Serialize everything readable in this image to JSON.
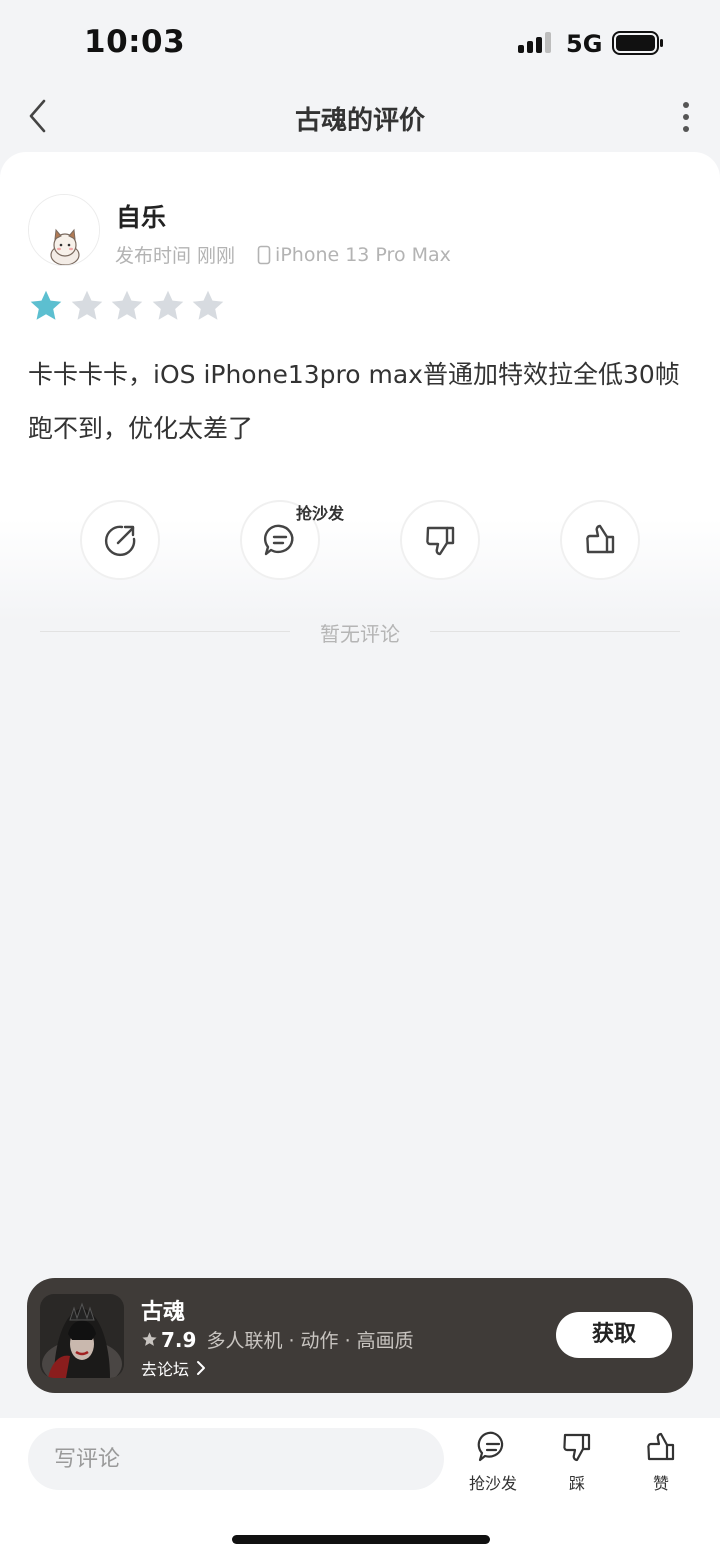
{
  "status_bar": {
    "time": "10:03",
    "network": "5G"
  },
  "nav": {
    "title": "古魂的评价"
  },
  "review": {
    "username": "自乐",
    "publish_time": "发布时间 刚刚",
    "device": "iPhone 13 Pro Max",
    "rating": 1,
    "rating_max": 5,
    "text": "卡卡卡卡，iOS iPhone13pro max普通加特效拉全低30帧跑不到，优化太差了"
  },
  "actions": {
    "sofa_tag": "抢沙发"
  },
  "comments": {
    "empty_text": "暂无评论"
  },
  "game": {
    "name": "古魂",
    "score": "7.9",
    "tags": "多人联机 · 动作 · 高画质",
    "forum_link": "去论坛",
    "get_label": "获取"
  },
  "bottom_bar": {
    "input_placeholder": "写评论",
    "sofa_label": "抢沙发",
    "dislike_label": "踩",
    "like_label": "赞"
  },
  "colors": {
    "star_active": "#5cbfd0",
    "star_inactive": "#d7dbe0",
    "banner_bg": "#3f3b38"
  }
}
